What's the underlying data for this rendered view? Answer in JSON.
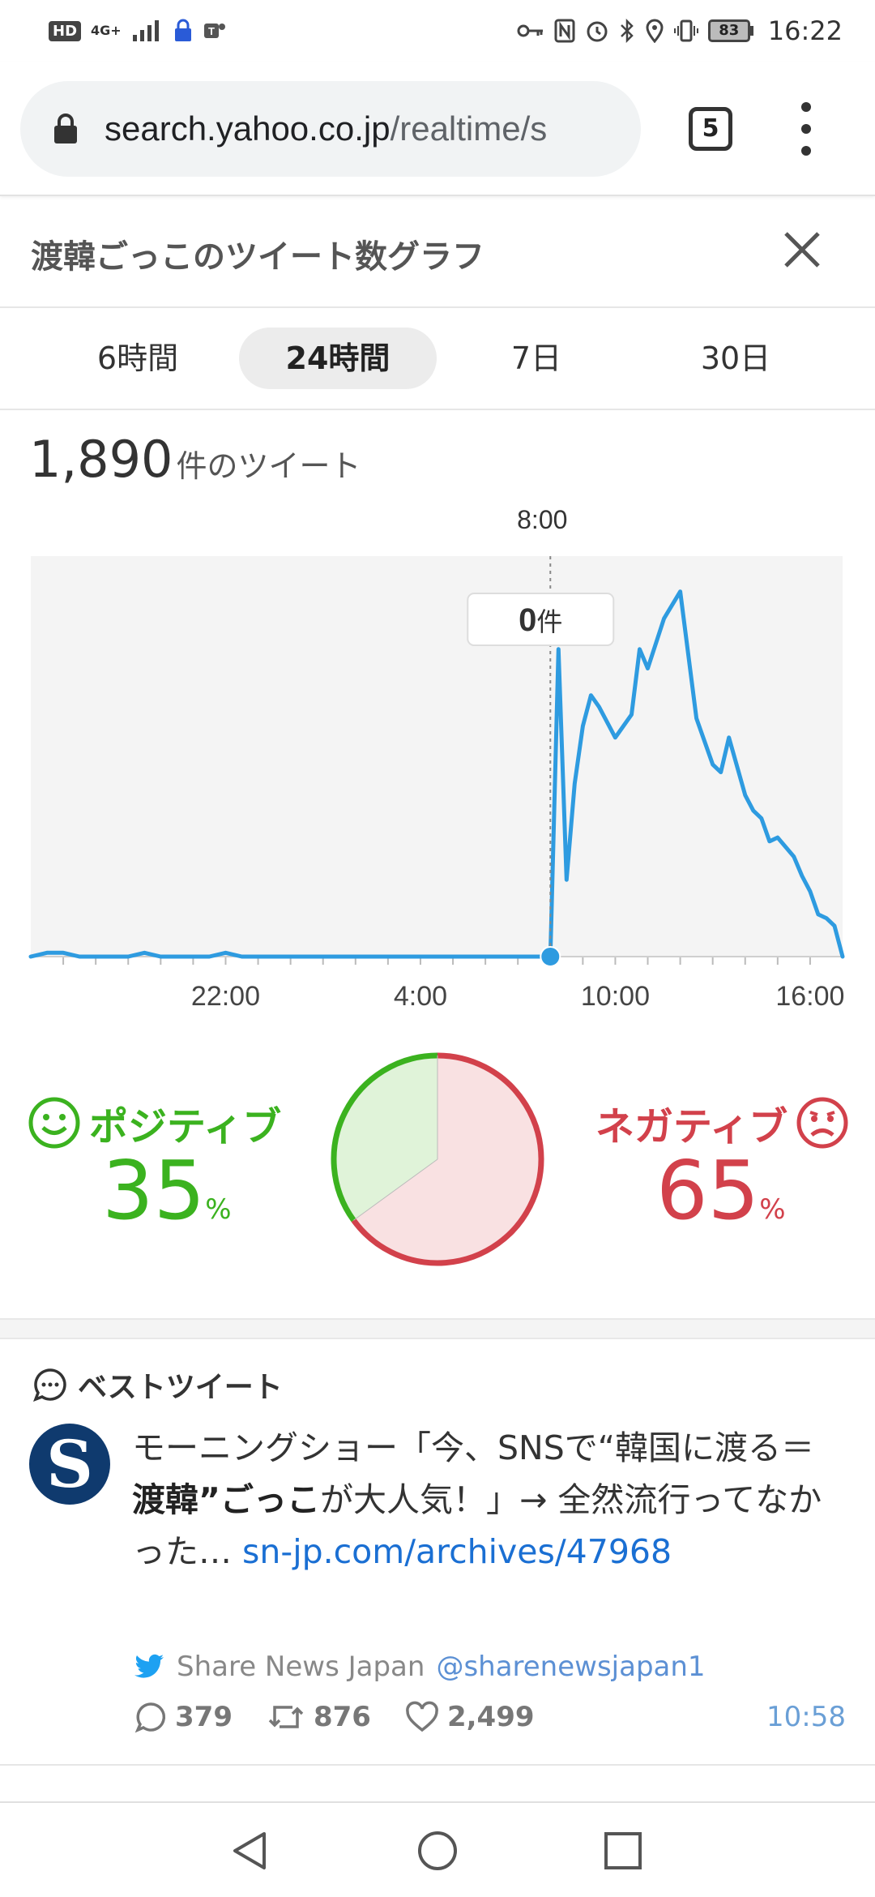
{
  "status_bar": {
    "hd": "HD",
    "network": "4G+",
    "battery": "83",
    "time": "16:22"
  },
  "browser": {
    "url_host": "search.yahoo.co.jp",
    "url_path": "/realtime/s",
    "tab_count": "5"
  },
  "panel": {
    "title": "渡韓ごっこのツイート数グラフ"
  },
  "range_tabs": [
    {
      "label": "6時間",
      "active": false
    },
    {
      "label": "24時間",
      "active": true
    },
    {
      "label": "7日",
      "active": false
    },
    {
      "label": "30日",
      "active": false
    }
  ],
  "summary": {
    "count": "1,890",
    "unit": "件のツイート"
  },
  "chart_data": {
    "type": "line",
    "title": "",
    "x_tick_labels": [
      "22:00",
      "4:00",
      "10:00",
      "16:00"
    ],
    "cursor_label": "8:00",
    "tooltip_value": "0",
    "tooltip_unit": "件",
    "series": [
      {
        "color": "#2e9be0",
        "x": [
          16.0,
          16.5,
          17.0,
          17.5,
          18.0,
          18.5,
          19.0,
          19.5,
          20.0,
          20.5,
          21.0,
          21.5,
          22.0,
          22.5,
          23.0,
          23.5,
          24.0,
          24.5,
          25.0,
          25.5,
          26.0,
          26.5,
          27.0,
          27.5,
          28.0,
          28.5,
          29.0,
          29.5,
          30.0,
          30.5,
          31.0,
          31.5,
          32.0,
          32.25,
          32.5,
          32.75,
          33.0,
          33.25,
          33.5,
          34.0,
          34.5,
          34.75,
          35.0,
          35.5,
          36.0,
          36.5,
          37.0,
          37.25,
          37.5,
          38.0,
          38.25,
          38.5,
          38.75,
          39.0,
          39.5,
          39.75,
          40.0,
          40.25,
          40.5,
          40.75,
          41.0
        ],
        "values": [
          0,
          1,
          1,
          0,
          0,
          0,
          0,
          1,
          0,
          0,
          0,
          0,
          1,
          0,
          0,
          0,
          0,
          0,
          0,
          0,
          0,
          0,
          0,
          0,
          0,
          0,
          0,
          0,
          0,
          0,
          0,
          0,
          0,
          80,
          20,
          45,
          60,
          68,
          65,
          57,
          63,
          80,
          75,
          88,
          95,
          62,
          50,
          48,
          57,
          42,
          38,
          36,
          30,
          31,
          26,
          21,
          17,
          11,
          10,
          8,
          0
        ]
      }
    ]
  },
  "sentiment": {
    "positive_label": "ポジティブ",
    "positive_value": "35",
    "negative_label": "ネガティブ",
    "negative_value": "65",
    "pct": "%",
    "positive_fraction": 0.35,
    "negative_fraction": 0.65,
    "positive_color": "#3bb21f",
    "negative_color": "#d2414b"
  },
  "best_tweet": {
    "heading": "ベストツイート",
    "avatar_letter": "S",
    "text_1": "モーニングショー「今、SNSで“韓国に渡る＝",
    "text_bold_1": "渡韓",
    "text_2": "”",
    "text_bold_2": "ごっこ",
    "text_3": "が大人気！」→ 全然流行ってなかった… ",
    "link": "sn-jp.com/archives/47968",
    "author": "Share News Japan",
    "handle": "@sharenewsjapan1",
    "replies": "379",
    "retweets": "876",
    "likes": "2,499",
    "time": "10:58"
  }
}
